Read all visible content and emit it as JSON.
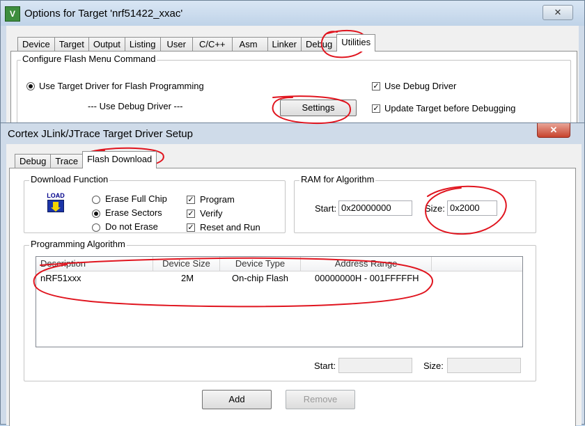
{
  "window": {
    "title": "Options for Target 'nrf51422_xxac'",
    "icon": "uvision-icon",
    "close_label": "✕",
    "tabs": [
      {
        "label": "Device"
      },
      {
        "label": "Target"
      },
      {
        "label": "Output"
      },
      {
        "label": "Listing"
      },
      {
        "label": "User"
      },
      {
        "label": "C/C++"
      },
      {
        "label": "Asm"
      },
      {
        "label": "Linker"
      },
      {
        "label": "Debug"
      },
      {
        "label": "Utilities",
        "active": true
      }
    ],
    "flash_menu": {
      "group_label": "Configure Flash Menu Command",
      "use_target_driver_label": "Use Target Driver for Flash Programming",
      "driver_selected": "--- Use Debug Driver ---",
      "settings_label": "Settings",
      "use_debug_driver_label": "Use Debug Driver",
      "use_debug_driver_checked": true,
      "update_target_label": "Update Target before Debugging",
      "update_target_checked": true
    }
  },
  "dialog": {
    "title": "Cortex JLink/JTrace Target Driver Setup",
    "close_label": "✕",
    "tabs": [
      {
        "label": "Debug"
      },
      {
        "label": "Trace"
      },
      {
        "label": "Flash Download",
        "active": true
      }
    ],
    "download_function": {
      "group_label": "Download Function",
      "load_icon_text": "LOAD",
      "erase_full_chip": "Erase Full Chip",
      "erase_sectors": "Erase Sectors",
      "do_not_erase": "Do not Erase",
      "erase_selected": "Erase Sectors",
      "program": "Program",
      "verify": "Verify",
      "reset_and_run": "Reset and Run",
      "program_checked": true,
      "verify_checked": true,
      "reset_checked": true
    },
    "ram": {
      "group_label": "RAM for Algorithm",
      "start_label": "Start:",
      "start_value": "0x20000000",
      "size_label": "Size:",
      "size_value": "0x2000"
    },
    "algorithm": {
      "group_label": "Programming Algorithm",
      "columns": [
        "Description",
        "Device Size",
        "Device Type",
        "Address Range"
      ],
      "rows": [
        {
          "description": "nRF51xxx",
          "size": "2M",
          "type": "On-chip Flash",
          "range": "00000000H - 001FFFFFH"
        }
      ],
      "start_label": "Start:",
      "size_label": "Size:",
      "start_value": "",
      "size_value": ""
    },
    "buttons": {
      "add": "Add",
      "remove": "Remove"
    }
  },
  "colors": {
    "annotation": "#e0141e",
    "window_frame": "#cfdbe9",
    "dialog_face": "#f0f0f0"
  }
}
